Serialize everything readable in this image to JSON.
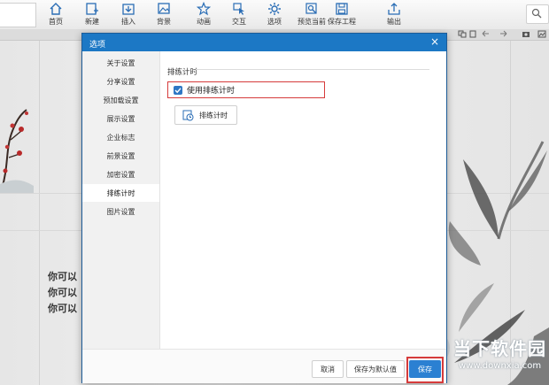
{
  "toolbar": {
    "items": [
      {
        "label": "首页",
        "icon": "home-icon"
      },
      {
        "label": "新建",
        "icon": "new-page-icon"
      },
      {
        "label": "插入",
        "icon": "insert-icon"
      },
      {
        "label": "背景",
        "icon": "background-icon"
      },
      {
        "label": "动画",
        "icon": "animation-icon"
      },
      {
        "label": "交互",
        "icon": "interact-icon"
      },
      {
        "label": "选项",
        "icon": "gear-icon"
      },
      {
        "label": "预览当前",
        "icon": "preview-icon"
      },
      {
        "label": "保存工程",
        "icon": "save-icon"
      },
      {
        "label": "输出",
        "icon": "export-icon"
      }
    ]
  },
  "background": {
    "lines": [
      "你可以",
      "你可以",
      "你可以"
    ],
    "watermark_title": "当下软件园",
    "watermark_url": "www.downxia.com"
  },
  "dialog": {
    "title": "选项",
    "close_symbol": "×",
    "nav": [
      "关于设置",
      "分享设置",
      "预加载设置",
      "展示设置",
      "企业标志",
      "前景设置",
      "加密设置",
      "排练计时",
      "图片设置"
    ],
    "active_nav_index": 7,
    "section_title": "排练计时",
    "checkbox_label": "使用排练计时",
    "checkbox_checked": true,
    "rehearse_button": "排练计时",
    "footer": {
      "cancel": "取消",
      "save_default": "保存为默认值",
      "save": "保存"
    }
  },
  "colors": {
    "title_bar": "#1c78c5",
    "primary_button": "#2b80d2",
    "highlight": "#d63b3b"
  }
}
